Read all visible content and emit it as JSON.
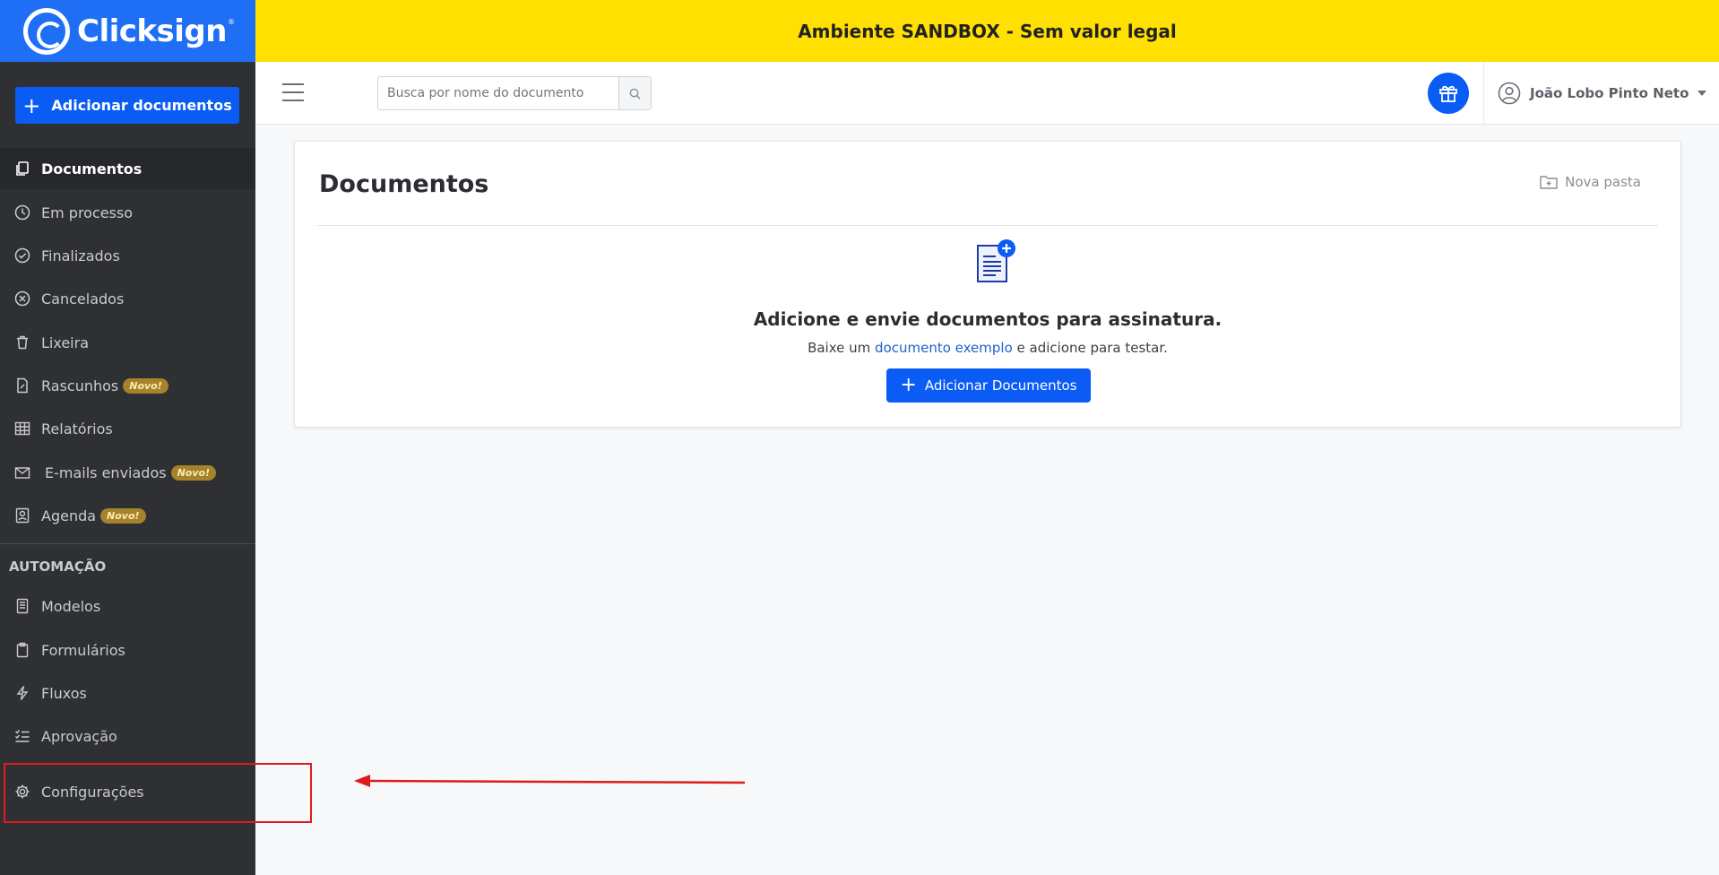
{
  "app": {
    "brand": "Clicksign",
    "registered": "®"
  },
  "banner": {
    "text": "Ambiente SANDBOX - Sem valor legal"
  },
  "sidebar": {
    "add_button": "Adicionar documentos",
    "items": [
      {
        "label": "Documentos",
        "icon": "documents-icon"
      },
      {
        "label": "Em processo",
        "icon": "clock-icon"
      },
      {
        "label": "Finalizados",
        "icon": "check-circle-icon"
      },
      {
        "label": "Cancelados",
        "icon": "x-circle-icon"
      },
      {
        "label": "Lixeira",
        "icon": "trash-icon"
      },
      {
        "label": "Rascunhos",
        "icon": "draft-icon",
        "badge": "Novo!"
      },
      {
        "label": "Relatórios",
        "icon": "table-icon"
      },
      {
        "label": "E-mails enviados",
        "icon": "email-icon",
        "badge": "Novo!"
      },
      {
        "label": "Agenda",
        "icon": "contact-icon",
        "badge": "Novo!"
      }
    ],
    "automation_label": "AUTOMAÇÃO",
    "automation_items": [
      {
        "label": "Modelos",
        "icon": "template-icon"
      },
      {
        "label": "Formulários",
        "icon": "clipboard-icon"
      },
      {
        "label": "Fluxos",
        "icon": "lightning-icon"
      },
      {
        "label": "Aprovação",
        "icon": "checklist-icon"
      }
    ],
    "settings": {
      "label": "Configurações",
      "icon": "gear-icon"
    }
  },
  "topbar": {
    "search_placeholder": "Busca por nome do documento",
    "user_name": "João Lobo Pinto Neto"
  },
  "main": {
    "title": "Documentos",
    "new_folder": "Nova pasta",
    "empty_title": "Adicione e envie documentos para assinatura.",
    "empty_sub_prefix": "Baixe um",
    "empty_sub_link": "documento exemplo",
    "empty_sub_suffix": "e adicione para testar.",
    "add_button": "Adicionar Documentos"
  },
  "colors": {
    "primary": "#0a5cf5",
    "sidebar": "#2f3034",
    "banner": "#ffe000",
    "badge": "#a4832a",
    "annotation": "#e01b1b"
  }
}
